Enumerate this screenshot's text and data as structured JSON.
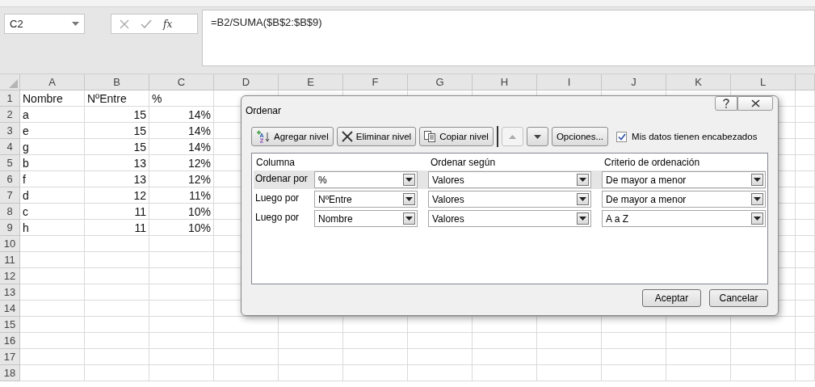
{
  "formula_bar": {
    "name_box": "C2",
    "function_label": "fx",
    "formula": "=B2/SUMA($B$2:$B$9)"
  },
  "sheet": {
    "columns": [
      "A",
      "B",
      "C",
      "D",
      "E",
      "F",
      "G",
      "H",
      "I",
      "J",
      "K",
      "L"
    ],
    "rows": [
      {
        "number": "1",
        "kind": "header",
        "cells": [
          "Nombre",
          "NºEntre",
          "%"
        ]
      },
      {
        "number": "2",
        "kind": "data",
        "cells": [
          "a",
          "15",
          "14%"
        ]
      },
      {
        "number": "3",
        "kind": "data",
        "cells": [
          "e",
          "15",
          "14%"
        ]
      },
      {
        "number": "4",
        "kind": "data",
        "cells": [
          "g",
          "15",
          "14%"
        ]
      },
      {
        "number": "5",
        "kind": "data",
        "cells": [
          "b",
          "13",
          "12%"
        ]
      },
      {
        "number": "6",
        "kind": "data",
        "cells": [
          "f",
          "13",
          "12%"
        ]
      },
      {
        "number": "7",
        "kind": "data",
        "cells": [
          "d",
          "12",
          "11%"
        ]
      },
      {
        "number": "8",
        "kind": "data",
        "cells": [
          "c",
          "11",
          "10%"
        ]
      },
      {
        "number": "9",
        "kind": "data",
        "cells": [
          "h",
          "11",
          "10%"
        ]
      },
      {
        "number": "10",
        "kind": "empty",
        "cells": []
      },
      {
        "number": "11",
        "kind": "empty",
        "cells": []
      },
      {
        "number": "12",
        "kind": "empty",
        "cells": []
      },
      {
        "number": "13",
        "kind": "empty",
        "cells": []
      },
      {
        "number": "14",
        "kind": "empty",
        "cells": []
      },
      {
        "number": "15",
        "kind": "empty",
        "cells": []
      },
      {
        "number": "16",
        "kind": "empty",
        "cells": []
      },
      {
        "number": "17",
        "kind": "empty",
        "cells": []
      },
      {
        "number": "18",
        "kind": "empty",
        "cells": []
      }
    ]
  },
  "dialog": {
    "title": "Ordenar",
    "toolbar": [
      {
        "kind": "add",
        "label": "Agregar nivel",
        "disabled": false
      },
      {
        "kind": "delete",
        "label": "Eliminar nivel",
        "disabled": false
      },
      {
        "kind": "copy",
        "label": "Copiar nivel",
        "disabled": false
      },
      {
        "kind": "up",
        "disabled": true
      },
      {
        "kind": "down",
        "disabled": false
      },
      {
        "kind": "options",
        "label": "Opciones...",
        "disabled": false
      }
    ],
    "headers_checkbox": {
      "label": "Mis datos tienen encabezados",
      "checked": true
    },
    "columns": [
      "Columna",
      "Ordenar según",
      "Criterio de ordenación"
    ],
    "levels": [
      {
        "label": "Ordenar por",
        "column": "%",
        "sort_on": "Valores",
        "order": "De mayor a menor",
        "selected": true
      },
      {
        "label": "Luego por",
        "column": "NºEntre",
        "sort_on": "Valores",
        "order": "De mayor a menor",
        "selected": false
      },
      {
        "label": "Luego por",
        "column": "Nombre",
        "sort_on": "Valores",
        "order": "A a Z",
        "selected": false
      }
    ],
    "buttons": [
      "Aceptar",
      "Cancelar"
    ]
  }
}
